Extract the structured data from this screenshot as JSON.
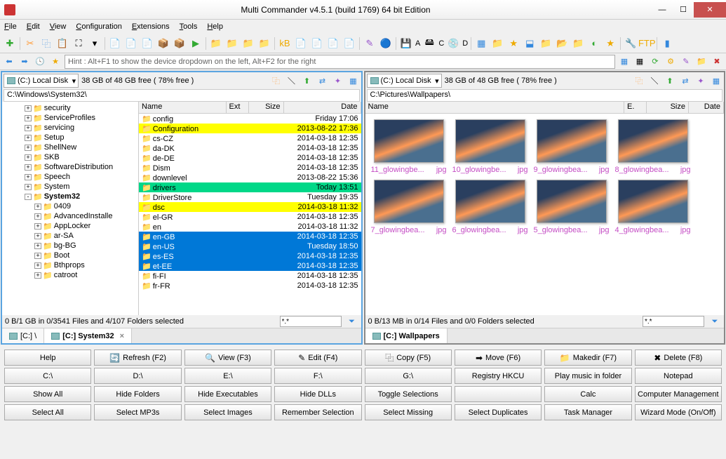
{
  "title": "Multi Commander v4.5.1 (build 1769) 64 bit Edition",
  "menu": [
    "File",
    "Edit",
    "View",
    "Configuration",
    "Extensions",
    "Tools",
    "Help"
  ],
  "hint": "Hint : Alt+F1 to show the device dropdown on the left, Alt+F2 for the right",
  "drive_letters": {
    "a": "A",
    "c": "C",
    "d": "D"
  },
  "left": {
    "drive": "(C:) Local Disk",
    "free": "38 GB of 48 GB free ( 78% free )",
    "path": "C:\\Windows\\System32\\",
    "cols": {
      "name": "Name",
      "ext": "Ext",
      "size": "Size",
      "date": "Date"
    },
    "tree": [
      {
        "ind": 2,
        "exp": "+",
        "name": "security",
        "bold": false
      },
      {
        "ind": 2,
        "exp": "+",
        "name": "ServiceProfiles",
        "bold": false
      },
      {
        "ind": 2,
        "exp": "+",
        "name": "servicing",
        "bold": false
      },
      {
        "ind": 2,
        "exp": "+",
        "name": "Setup",
        "bold": false
      },
      {
        "ind": 2,
        "exp": "+",
        "name": "ShellNew",
        "bold": false
      },
      {
        "ind": 2,
        "exp": "+",
        "name": "SKB",
        "bold": false
      },
      {
        "ind": 2,
        "exp": "+",
        "name": "SoftwareDistribution",
        "bold": false
      },
      {
        "ind": 2,
        "exp": "+",
        "name": "Speech",
        "bold": false
      },
      {
        "ind": 2,
        "exp": "+",
        "name": "System",
        "bold": false
      },
      {
        "ind": 2,
        "exp": "-",
        "name": "System32",
        "bold": true
      },
      {
        "ind": 3,
        "exp": "+",
        "name": "0409",
        "bold": false
      },
      {
        "ind": 3,
        "exp": "+",
        "name": "AdvancedInstalle",
        "bold": false
      },
      {
        "ind": 3,
        "exp": "+",
        "name": "AppLocker",
        "bold": false
      },
      {
        "ind": 3,
        "exp": "+",
        "name": "ar-SA",
        "bold": false
      },
      {
        "ind": 3,
        "exp": "+",
        "name": "bg-BG",
        "bold": false
      },
      {
        "ind": 3,
        "exp": "+",
        "name": "Boot",
        "bold": false
      },
      {
        "ind": 3,
        "exp": "+",
        "name": "Bthprops",
        "bold": false
      },
      {
        "ind": 3,
        "exp": "+",
        "name": "catroot",
        "bold": false
      }
    ],
    "rows": [
      {
        "name": "config",
        "date": "Friday 17:06",
        "hl": ""
      },
      {
        "name": "Configuration",
        "date": "2013-08-22 17:36",
        "hl": "yellow"
      },
      {
        "name": "cs-CZ",
        "date": "2014-03-18 12:35",
        "hl": ""
      },
      {
        "name": "da-DK",
        "date": "2014-03-18 12:35",
        "hl": ""
      },
      {
        "name": "de-DE",
        "date": "2014-03-18 12:35",
        "hl": ""
      },
      {
        "name": "Dism",
        "date": "2014-03-18 12:35",
        "hl": ""
      },
      {
        "name": "downlevel",
        "date": "2013-08-22 15:36",
        "hl": ""
      },
      {
        "name": "drivers",
        "date": "Today 13:51",
        "hl": "green"
      },
      {
        "name": "DriverStore",
        "date": "Tuesday 19:35",
        "hl": ""
      },
      {
        "name": "dsc",
        "date": "2014-03-18 11:32",
        "hl": "yellow"
      },
      {
        "name": "el-GR",
        "date": "2014-03-18 12:35",
        "hl": ""
      },
      {
        "name": "en",
        "date": "2014-03-18 11:32",
        "hl": ""
      },
      {
        "name": "en-GB",
        "date": "2014-03-18 12:35",
        "hl": "blue"
      },
      {
        "name": "en-US",
        "date": "Tuesday 18:50",
        "hl": "blue"
      },
      {
        "name": "es-ES",
        "date": "2014-03-18 12:35",
        "hl": "blue"
      },
      {
        "name": "et-EE",
        "date": "2014-03-18 12:35",
        "hl": "blue"
      },
      {
        "name": "fi-FI",
        "date": "2014-03-18 12:35",
        "hl": ""
      },
      {
        "name": "fr-FR",
        "date": "2014-03-18 12:35",
        "hl": ""
      }
    ],
    "status": "0 B/1 GB in 0/3541 Files and 4/107 Folders selected",
    "filter": "*.*",
    "tabs": [
      {
        "label": "[C:] \\",
        "active": false
      },
      {
        "label": "[C:] System32",
        "active": true,
        "close": true
      }
    ]
  },
  "right": {
    "drive": "(C:) Local Disk",
    "free": "38 GB of 48 GB free ( 78% free )",
    "path": "C:\\Pictures\\Wallpapers\\",
    "cols": {
      "name": "Name",
      "e": "E.",
      "size": "Size",
      "date": "Date"
    },
    "thumbs": [
      {
        "name": "11_glowingbe...",
        "ext": "jpg"
      },
      {
        "name": "10_glowingbe...",
        "ext": "jpg"
      },
      {
        "name": "9_glowingbea...",
        "ext": "jpg"
      },
      {
        "name": "8_glowingbea...",
        "ext": "jpg"
      },
      {
        "name": "7_glowingbea...",
        "ext": "jpg"
      },
      {
        "name": "6_glowingbea...",
        "ext": "jpg"
      },
      {
        "name": "5_glowingbea...",
        "ext": "jpg"
      },
      {
        "name": "4_glowingbea...",
        "ext": "jpg"
      }
    ],
    "status": "0 B/13 MB in 0/14 Files and 0/0 Folders selected",
    "filter": "*.*",
    "tabs": [
      {
        "label": "[C:] Wallpapers",
        "active": true
      }
    ]
  },
  "btns": [
    [
      "Help",
      "Refresh (F2)",
      "View (F3)",
      "Edit (F4)",
      "Copy (F5)",
      "Move (F6)",
      "Makedir (F7)",
      "Delete (F8)"
    ],
    [
      "C:\\",
      "D:\\",
      "E:\\",
      "F:\\",
      "G:\\",
      "Registry HKCU",
      "Play music in folder",
      "Notepad"
    ],
    [
      "Show All",
      "Hide Folders",
      "Hide Executables",
      "Hide DLLs",
      "Toggle Selections",
      "",
      "Calc",
      "Computer Management"
    ],
    [
      "Select All",
      "Select MP3s",
      "Select Images",
      "Remember Selection",
      "Select Missing",
      "Select Duplicates",
      "Task Manager",
      "Wizard Mode (On/Off)"
    ]
  ]
}
